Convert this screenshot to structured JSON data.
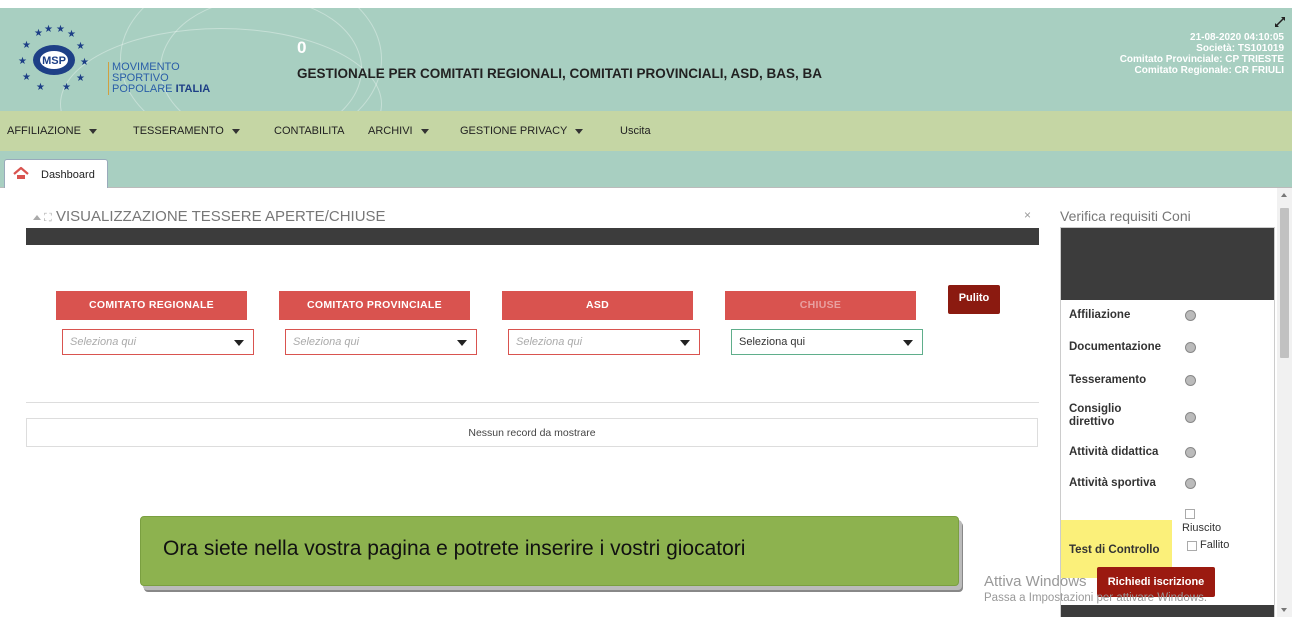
{
  "header": {
    "logo_lines": [
      "MOVIMENTO",
      "SPORTIVO",
      "POPOLARE"
    ],
    "logo_bold": "ITALIA",
    "logo_badge": "Italia",
    "counter": "0",
    "title": "GESTIONALE PER COMITATI REGIONALI, COMITATI PROVINCIALI, ASD, BAS, BA",
    "info": {
      "datetime": "21-08-2020 04:10:05",
      "societa": "Società: TS101019",
      "comitato_provinciale": "Comitato Provinciale: CP TRIESTE",
      "comitato_regionale": "Comitato Regionale: CR FRIULI"
    }
  },
  "menu": {
    "items": [
      {
        "label": "AFFILIAZIONE",
        "dropdown": true
      },
      {
        "label": "TESSERAMENTO",
        "dropdown": true
      },
      {
        "label": "CONTABILITA",
        "dropdown": false
      },
      {
        "label": "ARCHIVI",
        "dropdown": true
      },
      {
        "label": "GESTIONE PRIVACY",
        "dropdown": true
      },
      {
        "label": "Uscita",
        "dropdown": false
      }
    ]
  },
  "tabs": {
    "dashboard": "Dashboard"
  },
  "panel": {
    "title": "VISUALIZZAZIONE TESSERE APERTE/CHIUSE",
    "close": "×",
    "filters": [
      {
        "label": "COMITATO REGIONALE",
        "placeholder": "Seleziona qui"
      },
      {
        "label": "COMITATO PROVINCIALE",
        "placeholder": "Seleziona qui"
      },
      {
        "label": "ASD",
        "placeholder": "Seleziona qui"
      },
      {
        "label": "CHIUSE",
        "value": "Seleziona qui"
      }
    ],
    "clear_button": "Pulito",
    "empty_message": "Nessun record da mostrare"
  },
  "tooltip": {
    "text": "Ora siete nella vostra pagina e potrete inserire i vostri giocatori"
  },
  "sidebar": {
    "title": "Verifica requisiti Coni",
    "requirements": [
      "Affiliazione",
      "Documentazione",
      "Tesseramento",
      "Consiglio direttivo",
      "Attività didattica",
      "Attività sportiva"
    ],
    "test": {
      "label": "Test di Controllo",
      "success": "Riuscito",
      "failure": "Fallito"
    },
    "request_button": "Richiedi iscrizione"
  },
  "watermark": {
    "line1": "Attiva Windows",
    "line2": "Passa a Impostazioni per attivare Windows."
  },
  "colors": {
    "header_bg": "#a8cfc1",
    "menu_bg": "#c5d6a4",
    "filter_red": "#d9534f",
    "button_dark_red": "#8b1a10",
    "tooltip_green": "#8db24f",
    "highlight_yellow": "#fbf07a"
  }
}
